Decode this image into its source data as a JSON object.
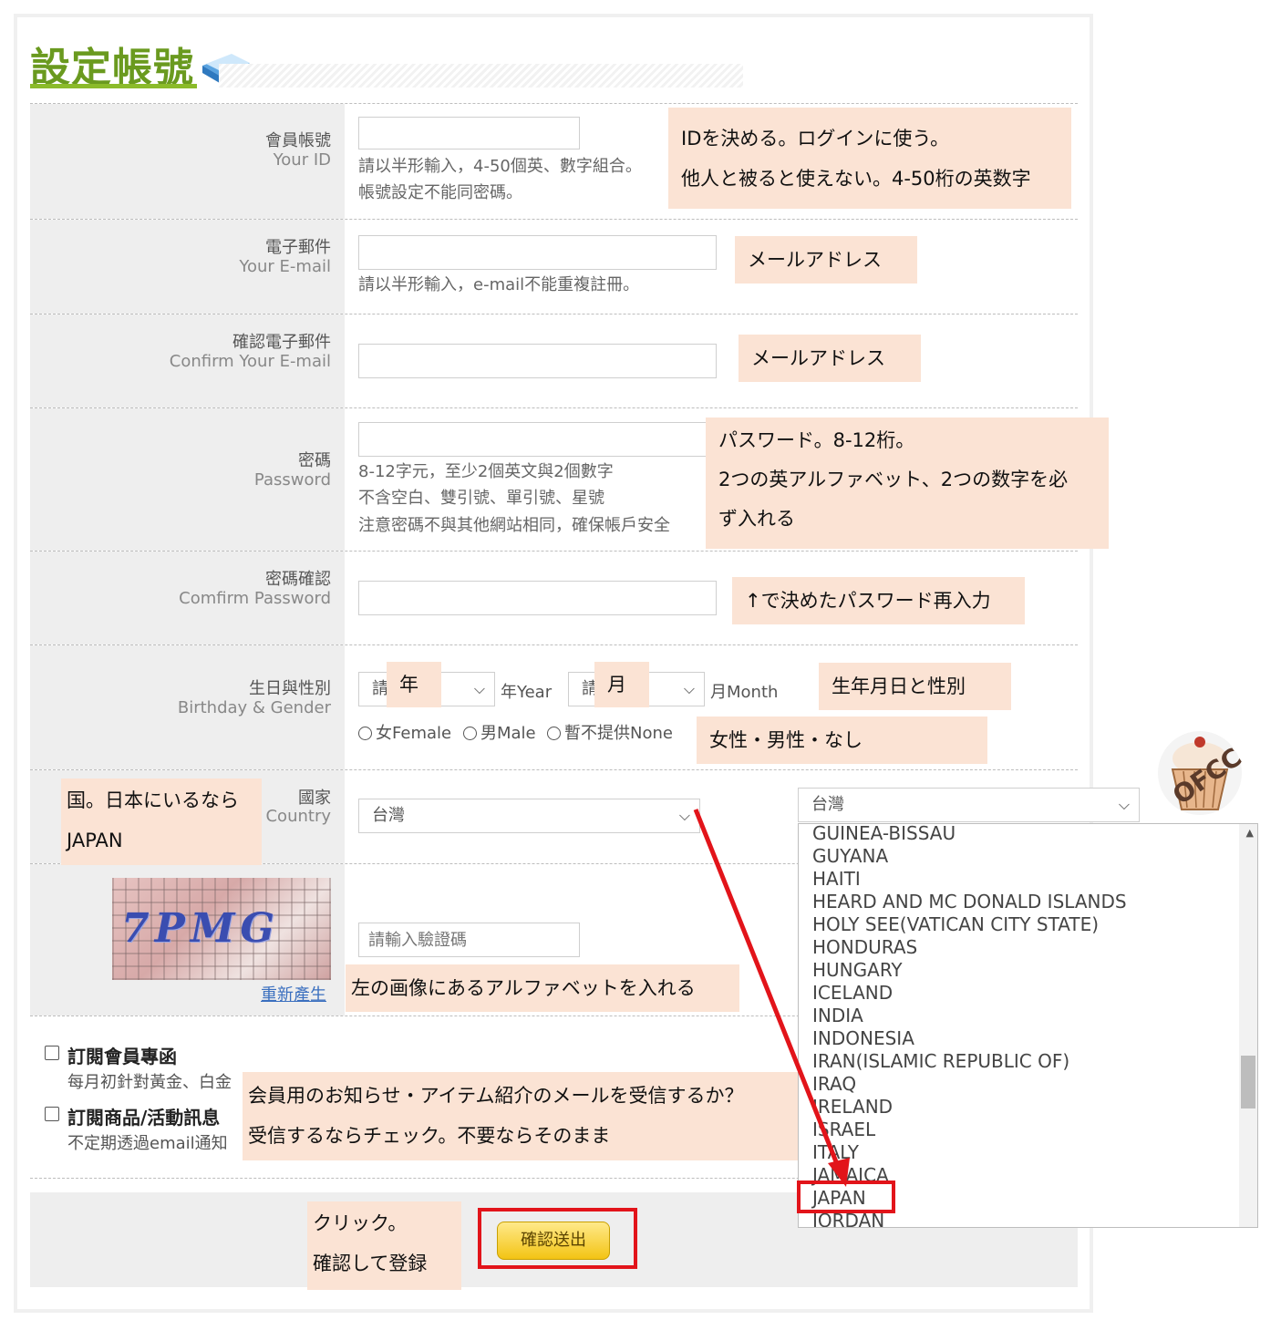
{
  "page": {
    "title": "設定帳號",
    "submit_label": "確認送出"
  },
  "fields": {
    "id": {
      "label_zh": "會員帳號",
      "label_en": "Your ID",
      "hint1": "請以半形輸入，4-50個英、數字組合。",
      "hint2": "帳號設定不能同密碼。"
    },
    "email": {
      "label_zh": "電子郵件",
      "label_en": "Your E-mail",
      "hint1": "請以半形輸入，e-mail不能重複註冊。"
    },
    "confirm_email": {
      "label_zh": "確認電子郵件",
      "label_en": "Confirm Your E-mail"
    },
    "password": {
      "label_zh": "密碼",
      "label_en": "Password",
      "hint1": "8-12字元，至少2個英文與2個數字",
      "hint2": "不含空白、雙引號、單引號、星號",
      "hint3": "注意密碼不與其他網站相同，確保帳戶安全"
    },
    "confirm_password": {
      "label_zh": "密碼確認",
      "label_en": "Comfirm Password"
    },
    "birthday": {
      "label_zh": "生日與性別",
      "label_en": "Birthday & Gender",
      "year_prefix": "請",
      "year_suffix": "年Year",
      "month_prefix": "請",
      "month_suffix": "月Month",
      "female": "女Female",
      "male": "男Male",
      "none": "暫不提供None"
    },
    "country": {
      "label_zh": "國家",
      "label_en": "Country",
      "value": "台灣"
    },
    "captcha": {
      "image_text": "7PMG",
      "placeholder": "請輸入驗證碼",
      "regenerate": "重新產生"
    }
  },
  "subscriptions": {
    "newsletter": {
      "title": "訂閱會員專函",
      "desc": "每月初針對黃金、白金"
    },
    "promotions": {
      "title": "訂閱商品/活動訊息",
      "desc": "不定期透過email通知"
    }
  },
  "annotations": {
    "id_note": [
      "IDを決める。ログインに使う。",
      "他人と被ると使えない。4-50桁の英数字"
    ],
    "email_note": "メールアドレス",
    "confirm_email_note": "メールアドレス",
    "password_note": [
      "パスワード。8-12桁。",
      "2つの英アルファベット、2つの数字を必",
      "ず入れる"
    ],
    "confirm_password_note": "↑で決めたパスワード再入力",
    "year_tag": "年",
    "month_tag": "月",
    "birthday_note": "生年月日と性別",
    "gender_note": "女性・男性・なし",
    "country_note": [
      "国。日本にいるなら",
      "JAPAN"
    ],
    "captcha_note": "左の画像にあるアルファベットを入れる",
    "subscription_note": [
      "会員用のお知らせ・アイテム紹介のメールを受信するか？",
      "受信するならチェック。不要ならそのまま"
    ],
    "submit_note": [
      "クリック。",
      "確認して登録"
    ]
  },
  "country_dropdown": {
    "selected": "台灣",
    "options": [
      "GUINEA-BISSAU",
      "GUYANA",
      "HAITI",
      "HEARD AND MC DONALD ISLANDS",
      "HOLY SEE(VATICAN CITY STATE)",
      "HONDURAS",
      "HUNGARY",
      "ICELAND",
      "INDIA",
      "INDONESIA",
      "IRAN(ISLAMIC REPUBLIC OF)",
      "IRAQ",
      "IRELAND",
      "ISRAEL",
      "ITALY",
      "JAMAICA",
      "JAPAN",
      "JORDAN"
    ],
    "highlighted": "JAPAN"
  },
  "mascot": {
    "text": "OFCC"
  },
  "colors": {
    "note_bg": "#fbe3d4",
    "highlight_red": "#e2141a",
    "title_green": "#6a9a1f",
    "button_yellow": "#f3c414"
  }
}
